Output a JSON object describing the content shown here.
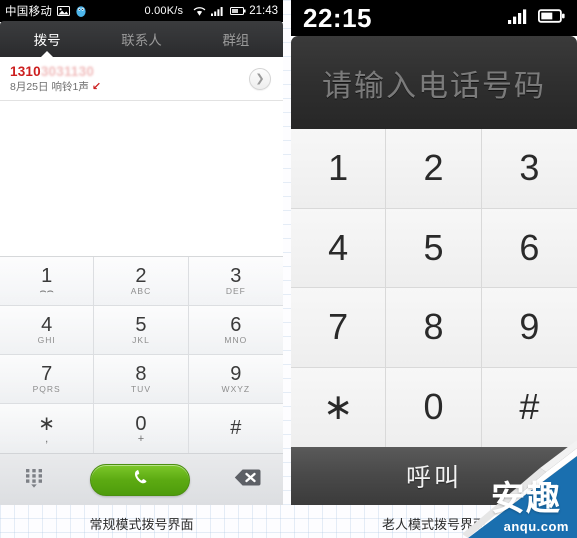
{
  "left_phone": {
    "status_bar": {
      "carrier": "中国移动",
      "icons": [
        "image-icon",
        "qq-penguin-icon"
      ],
      "net_speed": "0.00K/s",
      "wifi": "wifi-icon",
      "signal": "signal-icon",
      "battery": "battery-icon",
      "clock": "21:43"
    },
    "tabs": [
      {
        "label": "拨号",
        "active": true
      },
      {
        "label": "联系人",
        "active": false
      },
      {
        "label": "群组",
        "active": false
      }
    ],
    "call_log": [
      {
        "number_visible": "1310",
        "number_blurred": "3031130",
        "meta_date": "8月25日",
        "meta_detail": "响铃1声",
        "direction_icon": "incoming-call-arrow-icon",
        "detail_icon": "chevron-right-icon"
      }
    ],
    "keypad": [
      {
        "digit": "1",
        "sub": "⌢⌢",
        "sub_big": true
      },
      {
        "digit": "2",
        "sub": "ABC",
        "sub_big": false
      },
      {
        "digit": "3",
        "sub": "DEF",
        "sub_big": false
      },
      {
        "digit": "4",
        "sub": "GHI",
        "sub_big": false
      },
      {
        "digit": "5",
        "sub": "JKL",
        "sub_big": false
      },
      {
        "digit": "6",
        "sub": "MNO",
        "sub_big": false
      },
      {
        "digit": "7",
        "sub": "PQRS",
        "sub_big": false
      },
      {
        "digit": "8",
        "sub": "TUV",
        "sub_big": false
      },
      {
        "digit": "9",
        "sub": "WXYZ",
        "sub_big": false
      },
      {
        "digit": "∗",
        "sub": ",",
        "sub_big": true
      },
      {
        "digit": "0",
        "sub": "+",
        "sub_big": true
      },
      {
        "digit": "#",
        "sub": "",
        "sub_big": false
      }
    ],
    "actions": {
      "hide_keypad_icon": "keypad-hide-icon",
      "call_icon": "phone-handset-icon",
      "delete_icon": "backspace-delete-icon",
      "call_button_color": "#5caa12"
    },
    "caption": "常规模式拨号界面"
  },
  "right_phone": {
    "status_bar": {
      "clock": "22:15",
      "signal": "signal-icon",
      "battery": "battery-icon"
    },
    "display": {
      "placeholder": "请输入电话号码",
      "value": ""
    },
    "keypad": [
      "1",
      "2",
      "3",
      "4",
      "5",
      "6",
      "7",
      "8",
      "9",
      "∗",
      "0",
      "#"
    ],
    "call_button": {
      "label": "呼叫",
      "color": "#4a4a4a"
    },
    "caption": "老人模式拨号界面"
  },
  "watermark": {
    "cn_text": "安趣",
    "url_text": "anqu.com",
    "color": "#1a6faf"
  }
}
